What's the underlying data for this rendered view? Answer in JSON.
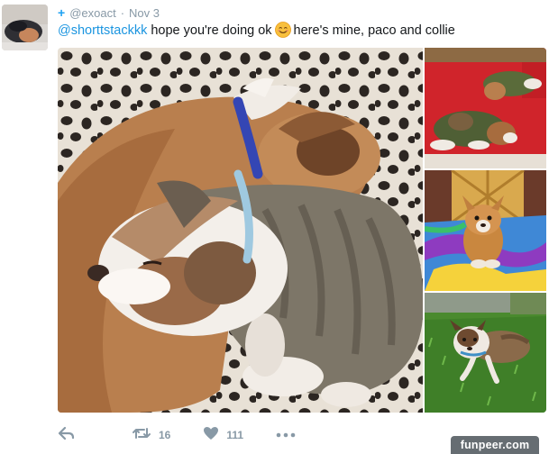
{
  "tweet": {
    "handle": "@exoact",
    "separator": "·",
    "date": "Nov 3",
    "mention": "@shorttstackkk",
    "text_before_emoji": "hope you're doing ok",
    "emoji_icon": "smiling-face-icon",
    "text_after_emoji": "here's mine, paco and collie"
  },
  "actions": {
    "retweet_count": "16",
    "like_count": "111"
  },
  "watermark": "funpeer.com",
  "colors": {
    "link": "#1b95e0",
    "muted": "#8899a6",
    "follow_accent": "#1da1f2"
  }
}
